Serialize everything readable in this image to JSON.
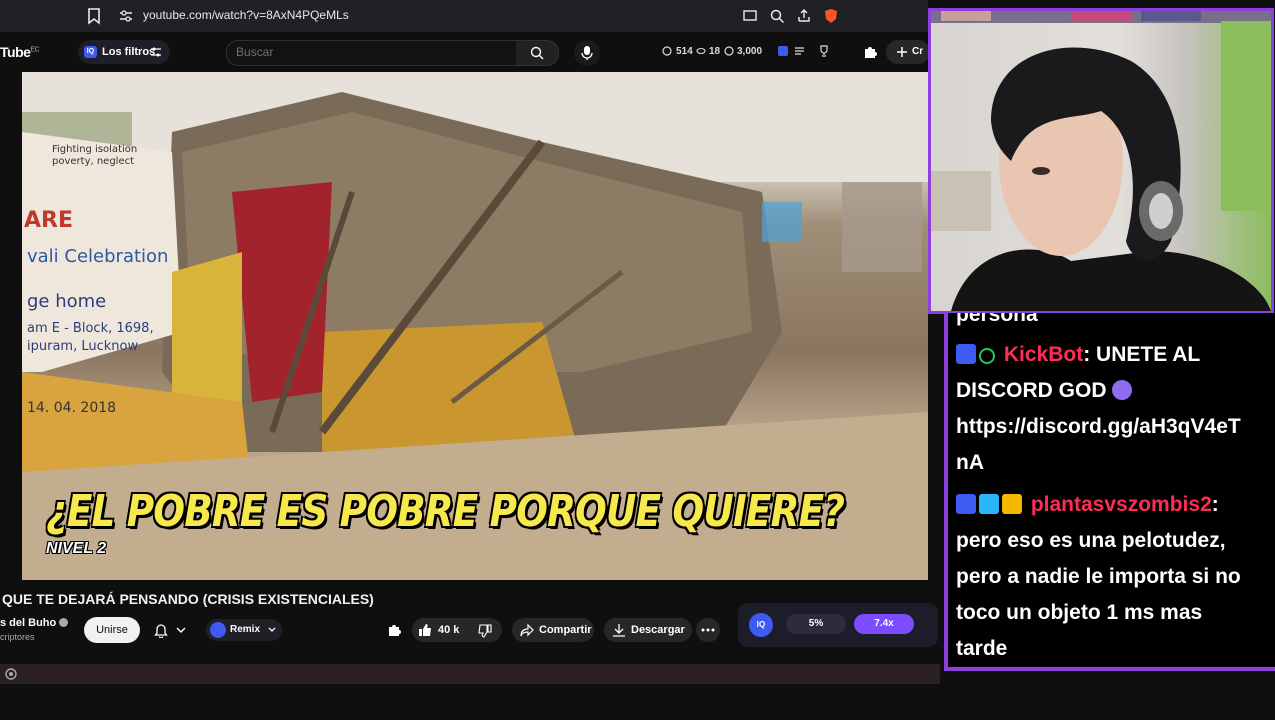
{
  "browser": {
    "url": "youtube.com/watch?v=8AxN4PQeMLs"
  },
  "yt_header": {
    "logo": "Tube",
    "logo_sup": "EC",
    "filters_badge": "IQ",
    "filters_label": "Los filtros",
    "search_placeholder": "Buscar",
    "stat_1": "514",
    "stat_2": "18",
    "stat_3": "3,000",
    "create_label": "Cr"
  },
  "video": {
    "caption": "¿EL POBRE ES POBRE PORQUE QUIERE?",
    "sub_caption": "NIVEL 2"
  },
  "below_video": {
    "title": "QUE TE DEJARÁ PENSANDO (CRISIS EXISTENCIALES)",
    "channel": "s del Buho",
    "subscribers": "criptores",
    "join_label": "Unirse",
    "remix_label": "Remix",
    "likes": "40 k",
    "share_label": "Compartir",
    "download_label": "Descargar",
    "ext_badge": "IQ",
    "percent": "5%",
    "speed": "7.4x"
  },
  "chat": {
    "lines": [
      {
        "text": "persona"
      },
      {
        "user": "KickBot",
        "user_color": "#ff2d55",
        "text": ": UNETE AL"
      },
      {
        "text": "DISCORD GOD"
      },
      {
        "text": "https://discord.gg/aH3qV4eT"
      },
      {
        "text": "nA"
      },
      {
        "user": "plantasvszombis2",
        "user_color": "#ff2d55",
        "text": ":"
      },
      {
        "text": "pero eso es una pelotudez,"
      },
      {
        "text": "pero a nadie le importa si no"
      },
      {
        "text": "toco un objeto 1 ms mas"
      },
      {
        "text": "tarde"
      }
    ]
  },
  "colors": {
    "accent_purple": "#8d3fe0",
    "iq_blue": "#3d5af1",
    "speed_purple": "#7b4dff",
    "caption_yellow": "#f7e84b"
  }
}
